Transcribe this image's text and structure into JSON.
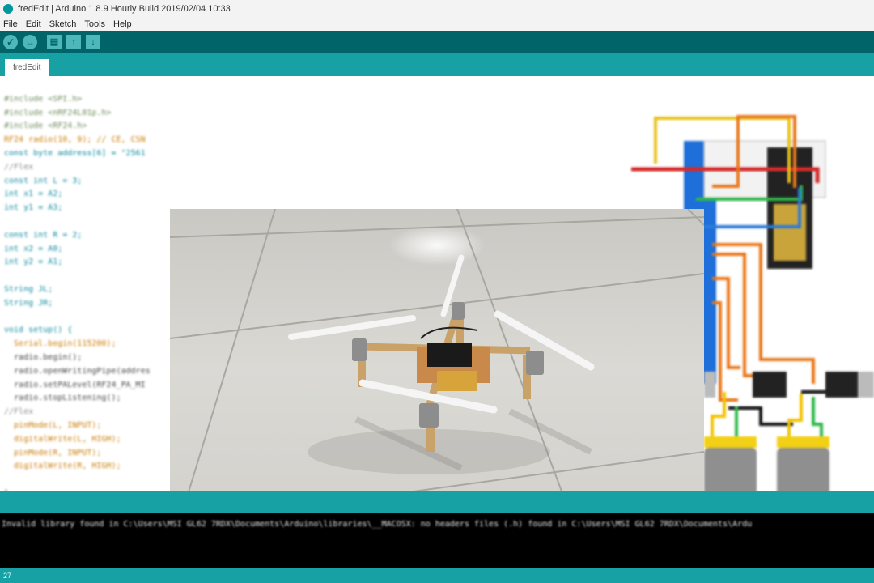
{
  "window": {
    "title": "fredEdit | Arduino 1.8.9 Hourly Build 2019/02/04 10:33"
  },
  "menu": [
    "File",
    "Edit",
    "Sketch",
    "Tools",
    "Help"
  ],
  "toolbar": {
    "verify": "✓",
    "upload": "→",
    "new": "▤",
    "open": "↑",
    "save": "↓"
  },
  "tabs": [
    {
      "label": "fredEdit"
    }
  ],
  "code": {
    "lines": [
      "#include <SPI.h>",
      "#include <nRF24L01p.h>",
      "#include <RF24.h>",
      "RF24 radio(10, 9); // CE, CSN",
      "const byte address[6] = \"2561",
      "//Flex",
      "const int L = 3;",
      "int x1 = A2;",
      "int y1 = A3;",
      "",
      "const int R = 2;",
      "int x2 = A0;",
      "int y2 = A1;",
      "",
      "String JL;",
      "String JR;",
      "",
      "void setup() {",
      "  Serial.begin(115200);",
      "  radio.begin();",
      "  radio.openWritingPipe(addres",
      "  radio.setPALevel(RF24_PA_MI",
      "  radio.stopListening();",
      "//Flex",
      "  pinMode(L, INPUT);",
      "  digitalWrite(L, HIGH);",
      "  pinMode(R, INPUT);",
      "  digitalWrite(R, HIGH);",
      "",
      "}"
    ]
  },
  "console": {
    "message": "Invalid library found in C:\\Users\\MSI GL62 7RDX\\Documents\\Arduino\\libraries\\__MACOSX: no headers files (.h) found in C:\\Users\\MSI GL62 7RDX\\Documents\\Ardu"
  },
  "statusbar": {
    "line": "27"
  },
  "colors": {
    "toolbar_bg": "#006468",
    "tab_bg": "#17a1a5",
    "console_bg": "#000000"
  }
}
